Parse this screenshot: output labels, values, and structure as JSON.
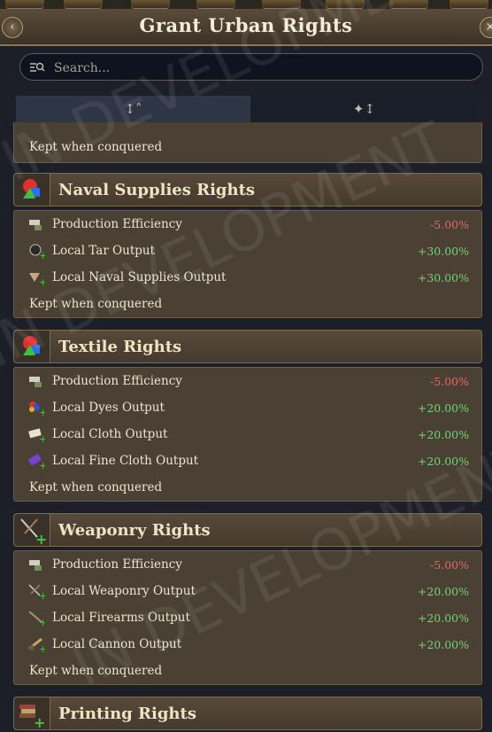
{
  "window": {
    "title": "Grant Urban Rights",
    "back_label": "‹",
    "close_label": "×"
  },
  "search": {
    "placeholder": "Search...",
    "value": ""
  },
  "sort_tabs": [
    {
      "label": "↕˄",
      "icon": "alphabet-sort-icon",
      "active": true
    },
    {
      "label": "✦↕",
      "icon": "star-sort-icon",
      "active": false
    }
  ],
  "partial_group": {
    "kept_label": "Kept when conquered"
  },
  "groups": [
    {
      "name": "Naval Supplies Rights",
      "icon": "rgb-shapes-icon",
      "modifiers": [
        {
          "label": "Production Efficiency",
          "value": "-5.00%",
          "sign": "neg",
          "icon": "production-icon"
        },
        {
          "label": "Local Tar Output",
          "value": "+30.00%",
          "sign": "pos",
          "icon": "tar-icon"
        },
        {
          "label": "Local Naval Supplies Output",
          "value": "+30.00%",
          "sign": "pos",
          "icon": "naval-supplies-icon"
        }
      ],
      "kept_label": "Kept when conquered"
    },
    {
      "name": "Textile Rights",
      "icon": "rgb-shapes-icon",
      "modifiers": [
        {
          "label": "Production Efficiency",
          "value": "-5.00%",
          "sign": "neg",
          "icon": "production-icon"
        },
        {
          "label": "Local Dyes Output",
          "value": "+20.00%",
          "sign": "pos",
          "icon": "dyes-icon"
        },
        {
          "label": "Local Cloth Output",
          "value": "+20.00%",
          "sign": "pos",
          "icon": "cloth-icon"
        },
        {
          "label": "Local Fine Cloth Output",
          "value": "+20.00%",
          "sign": "pos",
          "icon": "fine-cloth-icon"
        }
      ],
      "kept_label": "Kept when conquered"
    },
    {
      "name": "Weaponry Rights",
      "icon": "weaponry-icon",
      "modifiers": [
        {
          "label": "Production Efficiency",
          "value": "-5.00%",
          "sign": "neg",
          "icon": "production-icon"
        },
        {
          "label": "Local Weaponry Output",
          "value": "+20.00%",
          "sign": "pos",
          "icon": "weaponry-icon"
        },
        {
          "label": "Local Firearms Output",
          "value": "+20.00%",
          "sign": "pos",
          "icon": "firearms-icon"
        },
        {
          "label": "Local Cannon Output",
          "value": "+20.00%",
          "sign": "pos",
          "icon": "cannon-icon"
        }
      ],
      "kept_label": "Kept when conquered"
    },
    {
      "name": "Printing Rights",
      "icon": "books-icon",
      "modifiers": [],
      "kept_label": ""
    }
  ],
  "watermark": "IN DEVELOPMENT",
  "colors": {
    "negative": "#e06868",
    "positive": "#78d078",
    "gold_border": "#8c7650"
  }
}
